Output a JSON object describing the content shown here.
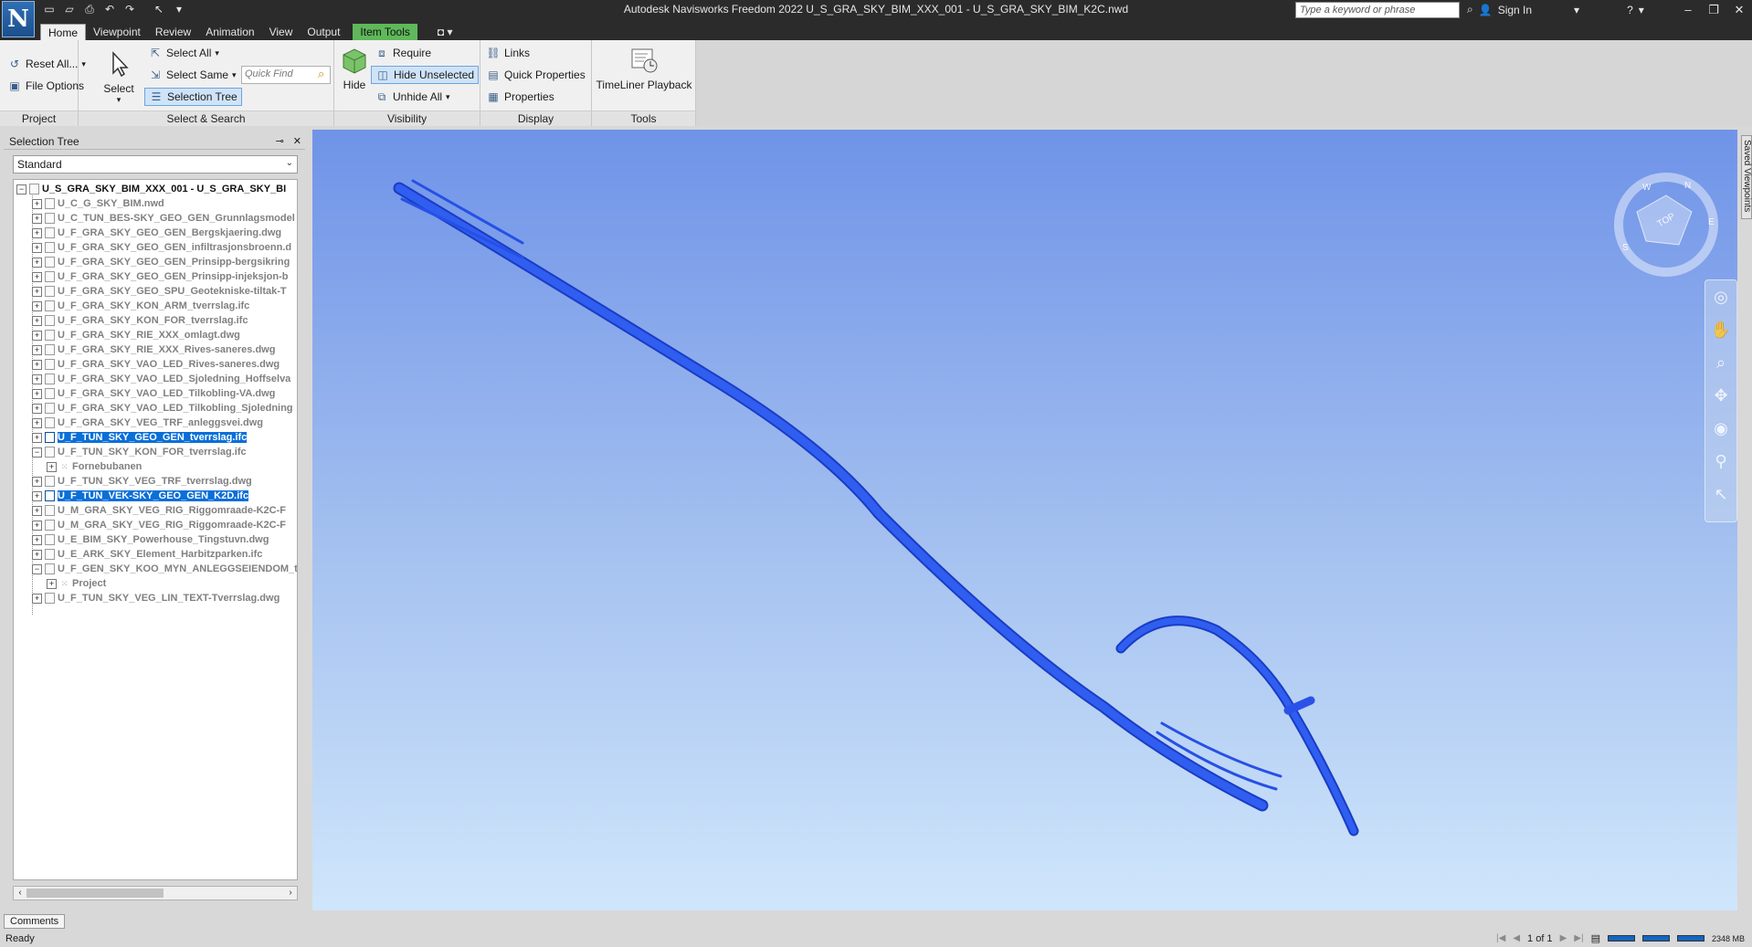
{
  "titlebar": {
    "app_logo": "N",
    "title": "Autodesk Navisworks Freedom 2022    U_S_GRA_SKY_BIM_XXX_001 - U_S_GRA_SKY_BIM_K2C.nwd",
    "search_placeholder": "Type a keyword or phrase",
    "sign_in": "Sign In"
  },
  "menu_tabs": {
    "home": "Home",
    "viewpoint": "Viewpoint",
    "review": "Review",
    "animation": "Animation",
    "view": "View",
    "output": "Output",
    "item_tools": "Item Tools"
  },
  "ribbon": {
    "project": {
      "title": "Project",
      "reset_all": "Reset All...",
      "file_options": "File Options"
    },
    "select_search": {
      "title": "Select & Search",
      "select": "Select",
      "select_all": "Select All",
      "select_same": "Select Same",
      "selection_tree": "Selection Tree",
      "quick_find_placeholder": "Quick Find"
    },
    "visibility": {
      "title": "Visibility",
      "hide": "Hide",
      "require": "Require",
      "hide_unselected": "Hide Unselected",
      "unhide_all": "Unhide All"
    },
    "display": {
      "title": "Display",
      "links": "Links",
      "quick_properties": "Quick Properties",
      "properties": "Properties"
    },
    "tools": {
      "title": "Tools",
      "timeliner_playback": "TimeLiner Playback"
    }
  },
  "selection_tree": {
    "title": "Selection Tree",
    "dropdown_value": "Standard",
    "root": "U_S_GRA_SKY_BIM_XXX_001 - U_S_GRA_SKY_BI",
    "items": [
      {
        "label": "U_C_G_SKY_BIM.nwd",
        "depth": 1,
        "expander": "+",
        "highlight": false,
        "icon": "file"
      },
      {
        "label": "U_C_TUN_BES-SKY_GEO_GEN_Grunnlagsmodel",
        "depth": 1,
        "expander": "+",
        "highlight": false,
        "icon": "file"
      },
      {
        "label": "U_F_GRA_SKY_GEO_GEN_Bergskjaering.dwg",
        "depth": 1,
        "expander": "+",
        "highlight": false,
        "icon": "file"
      },
      {
        "label": "U_F_GRA_SKY_GEO_GEN_infiltrasjonsbroenn.d",
        "depth": 1,
        "expander": "+",
        "highlight": false,
        "icon": "file"
      },
      {
        "label": "U_F_GRA_SKY_GEO_GEN_Prinsipp-bergsikring",
        "depth": 1,
        "expander": "+",
        "highlight": false,
        "icon": "file"
      },
      {
        "label": "U_F_GRA_SKY_GEO_GEN_Prinsipp-injeksjon-b",
        "depth": 1,
        "expander": "+",
        "highlight": false,
        "icon": "file"
      },
      {
        "label": "U_F_GRA_SKY_GEO_SPU_Geotekniske-tiltak-T",
        "depth": 1,
        "expander": "+",
        "highlight": false,
        "icon": "file"
      },
      {
        "label": "U_F_GRA_SKY_KON_ARM_tverrslag.ifc",
        "depth": 1,
        "expander": "+",
        "highlight": false,
        "icon": "file"
      },
      {
        "label": "U_F_GRA_SKY_KON_FOR_tverrslag.ifc",
        "depth": 1,
        "expander": "+",
        "highlight": false,
        "icon": "file"
      },
      {
        "label": "U_F_GRA_SKY_RIE_XXX_omlagt.dwg",
        "depth": 1,
        "expander": "+",
        "highlight": false,
        "icon": "file"
      },
      {
        "label": "U_F_GRA_SKY_RIE_XXX_Rives-saneres.dwg",
        "depth": 1,
        "expander": "+",
        "highlight": false,
        "icon": "file"
      },
      {
        "label": "U_F_GRA_SKY_VAO_LED_Rives-saneres.dwg",
        "depth": 1,
        "expander": "+",
        "highlight": false,
        "icon": "file"
      },
      {
        "label": "U_F_GRA_SKY_VAO_LED_Sjoledning_Hoffselva",
        "depth": 1,
        "expander": "+",
        "highlight": false,
        "icon": "file"
      },
      {
        "label": "U_F_GRA_SKY_VAO_LED_Tilkobling-VA.dwg",
        "depth": 1,
        "expander": "+",
        "highlight": false,
        "icon": "file"
      },
      {
        "label": "U_F_GRA_SKY_VAO_LED_Tilkobling_Sjoledning",
        "depth": 1,
        "expander": "+",
        "highlight": false,
        "icon": "file"
      },
      {
        "label": "U_F_GRA_SKY_VEG_TRF_anleggsvei.dwg",
        "depth": 1,
        "expander": "+",
        "highlight": false,
        "icon": "file"
      },
      {
        "label": "U_F_TUN_SKY_GEO_GEN_tverrslag.ifc",
        "depth": 1,
        "expander": "+",
        "highlight": true,
        "icon": "file"
      },
      {
        "label": "U_F_TUN_SKY_KON_FOR_tverrslag.ifc",
        "depth": 1,
        "expander": "-",
        "highlight": false,
        "icon": "file"
      },
      {
        "label": "Fornebubanen",
        "depth": 2,
        "expander": "+",
        "highlight": false,
        "icon": "group"
      },
      {
        "label": "U_F_TUN_SKY_VEG_TRF_tverrslag.dwg",
        "depth": 1,
        "expander": "+",
        "highlight": false,
        "icon": "file"
      },
      {
        "label": "U_F_TUN_VEK-SKY_GEO_GEN_K2D.ifc",
        "depth": 1,
        "expander": "+",
        "highlight": true,
        "icon": "file"
      },
      {
        "label": "U_M_GRA_SKY_VEG_RIG_Riggomraade-K2C-F",
        "depth": 1,
        "expander": "+",
        "highlight": false,
        "icon": "file"
      },
      {
        "label": "U_M_GRA_SKY_VEG_RIG_Riggomraade-K2C-F",
        "depth": 1,
        "expander": "+",
        "highlight": false,
        "icon": "file"
      },
      {
        "label": "U_E_BIM_SKY_Powerhouse_Tingstuvn.dwg",
        "depth": 1,
        "expander": "+",
        "highlight": false,
        "icon": "file"
      },
      {
        "label": "U_E_ARK_SKY_Element_Harbitzparken.ifc",
        "depth": 1,
        "expander": "+",
        "highlight": false,
        "icon": "file"
      },
      {
        "label": "U_F_GEN_SKY_KOO_MYN_ANLEGGSEIENDOM_t",
        "depth": 1,
        "expander": "-",
        "highlight": false,
        "icon": "file"
      },
      {
        "label": "Project",
        "depth": 2,
        "expander": "+",
        "highlight": false,
        "icon": "group"
      },
      {
        "label": "U_F_TUN_SKY_VEG_LIN_TEXT-Tverrslag.dwg",
        "depth": 1,
        "expander": "+",
        "highlight": false,
        "icon": "file"
      }
    ]
  },
  "viewport": {
    "viewcube_face": "TOP",
    "compass": {
      "n": "N",
      "e": "E",
      "s": "S",
      "w": "W"
    },
    "saved_viewpoints_tab": "Saved Viewpoints",
    "model_color": "#2a52e8"
  },
  "bottom": {
    "comments_tab": "Comments",
    "status": "Ready",
    "page_indicator": "1 of 1",
    "memory": "2348 MB"
  },
  "colors": {
    "titlebar_bg": "#2b2b2b",
    "ribbon_bg": "#f0f0f0",
    "selection_highlight": "#0a6fd8",
    "item_tools_tab": "#5fb85a"
  }
}
